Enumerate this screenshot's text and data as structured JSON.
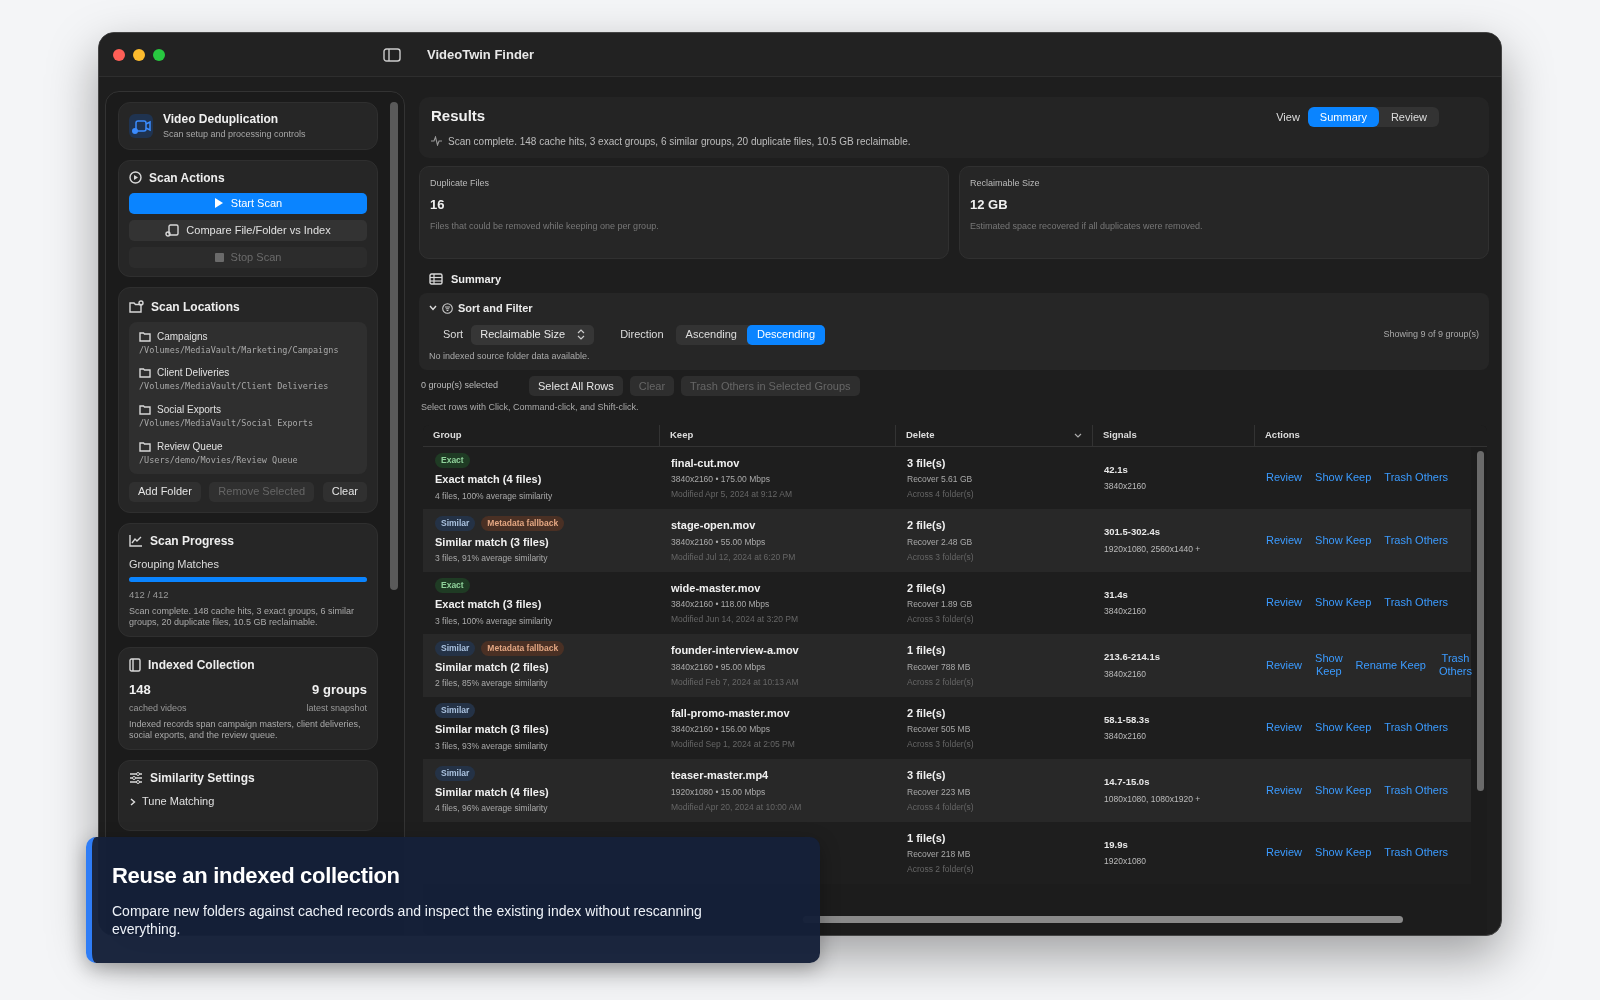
{
  "window": {
    "title": "VideoTwin Finder"
  },
  "sidebar": {
    "header": {
      "title": "Video Deduplication",
      "subtitle": "Scan setup and processing controls"
    },
    "scan_actions": {
      "title": "Scan Actions",
      "buttons": [
        {
          "label": "Start Scan",
          "kind": "primary"
        },
        {
          "label": "Compare File/Folder vs Index",
          "kind": "secondary"
        },
        {
          "label": "Stop Scan",
          "kind": "disabled"
        }
      ]
    },
    "scan_locations": {
      "title": "Scan Locations",
      "items": [
        {
          "name": "Campaigns",
          "path": "/Volumes/MediaVault/Marketing/Campaigns"
        },
        {
          "name": "Client Deliveries",
          "path": "/Volumes/MediaVault/Client Deliveries"
        },
        {
          "name": "Social Exports",
          "path": "/Volumes/MediaVault/Social Exports"
        },
        {
          "name": "Review Queue",
          "path": "/Users/demo/Movies/Review Queue"
        }
      ],
      "buttons": [
        {
          "label": "Add Folder",
          "disabled": false
        },
        {
          "label": "Remove Selected",
          "disabled": true
        },
        {
          "label": "Clear",
          "disabled": false
        }
      ]
    },
    "scan_progress": {
      "title": "Scan Progress",
      "stage": "Grouping Matches",
      "level": 1,
      "count": "412 / 412",
      "message": "Scan complete. 148 cache hits, 3 exact groups, 6 similar groups, 20 duplicate files, 10.5 GB reclaimable."
    },
    "indexed_collection": {
      "title": "Indexed Collection",
      "stats": [
        {
          "value": "148",
          "label": "cached videos"
        },
        {
          "value": "9 groups",
          "label": "latest snapshot"
        }
      ],
      "note": "Indexed records span campaign masters, client deliveries, social exports, and the review queue."
    },
    "similarity_settings": {
      "title": "Similarity Settings",
      "disclosure": {
        "label": "Tune Matching",
        "expanded": false
      }
    }
  },
  "results": {
    "title": "Results",
    "status": "Scan complete. 148 cache hits, 3 exact groups, 6 similar groups, 20 duplicate files, 10.5 GB reclaimable.",
    "view_label": "View",
    "view_tabs": [
      {
        "label": "Summary",
        "selected": true
      },
      {
        "label": "Review",
        "selected": false
      }
    ]
  },
  "stat_cards": [
    {
      "label": "Duplicate Files",
      "value": "16",
      "description": "Files that could be removed while keeping one per group."
    },
    {
      "label": "Reclaimable Size",
      "value": "12 GB",
      "description": "Estimated space recovered if all duplicates were removed."
    }
  ],
  "summary": {
    "title": "Summary",
    "sort_filter": {
      "title": "Sort and Filter",
      "expanded": true,
      "sort_label": "Sort",
      "sort_value": "Reclaimable Size",
      "direction_label": "Direction",
      "directions": [
        {
          "label": "Ascending",
          "selected": false
        },
        {
          "label": "Descending",
          "selected": true
        }
      ],
      "showing": "Showing 9 of 9 group(s)",
      "note": "No indexed source folder data available."
    },
    "selection": {
      "count": "0 group(s) selected",
      "buttons": [
        {
          "label": "Select All Rows",
          "disabled": false
        },
        {
          "label": "Clear",
          "disabled": true
        },
        {
          "label": "Trash Others in Selected Groups",
          "disabled": true
        }
      ],
      "hint": "Select rows with Click, Command-click, and Shift-click."
    }
  },
  "table": {
    "columns": [
      {
        "label": "Group",
        "sorted": false
      },
      {
        "label": "Keep",
        "sorted": false
      },
      {
        "label": "Delete",
        "sorted": true
      },
      {
        "label": "Signals",
        "sorted": false
      },
      {
        "label": "Actions",
        "sorted": false
      }
    ],
    "rows": [
      {
        "badges": [
          {
            "label": "Exact",
            "kind": "exact"
          }
        ],
        "group": "Exact match (4 files)",
        "group_detail": "4 files, 100% average similarity",
        "keep": "final-cut.mov",
        "keep_specs": "3840x2160 • 175.00 Mbps",
        "keep_modified": "Modified Apr 5, 2024 at 9:12 AM",
        "delete": "3 file(s)",
        "recover": "Recover 5.61 GB",
        "across": "Across 4 folder(s)",
        "duration": "42.1s",
        "resolution": "3840x2160",
        "actions": [
          "Review",
          "Show Keep",
          "Trash Others"
        ]
      },
      {
        "badges": [
          {
            "label": "Similar",
            "kind": "similar"
          },
          {
            "label": "Metadata fallback",
            "kind": "fallback"
          }
        ],
        "group": "Similar match (3 files)",
        "group_detail": "3 files, 91% average similarity",
        "keep": "stage-open.mov",
        "keep_specs": "3840x2160 • 55.00 Mbps",
        "keep_modified": "Modified Jul 12, 2024 at 6:20 PM",
        "delete": "2 file(s)",
        "recover": "Recover 2.48 GB",
        "across": "Across 3 folder(s)",
        "duration": "301.5-302.4s",
        "resolution": "1920x1080, 2560x1440 +",
        "actions": [
          "Review",
          "Show Keep",
          "Trash Others"
        ]
      },
      {
        "badges": [
          {
            "label": "Exact",
            "kind": "exact"
          }
        ],
        "group": "Exact match (3 files)",
        "group_detail": "3 files, 100% average similarity",
        "keep": "wide-master.mov",
        "keep_specs": "3840x2160 • 118.00 Mbps",
        "keep_modified": "Modified Jun 14, 2024 at 3:20 PM",
        "delete": "2 file(s)",
        "recover": "Recover 1.89 GB",
        "across": "Across 3 folder(s)",
        "duration": "31.4s",
        "resolution": "3840x2160",
        "actions": [
          "Review",
          "Show Keep",
          "Trash Others"
        ]
      },
      {
        "badges": [
          {
            "label": "Similar",
            "kind": "similar"
          },
          {
            "label": "Metadata fallback",
            "kind": "fallback"
          }
        ],
        "group": "Similar match (2 files)",
        "group_detail": "2 files, 85% average similarity",
        "keep": "founder-interview-a.mov",
        "keep_specs": "3840x2160 • 95.00 Mbps",
        "keep_modified": "Modified Feb 7, 2024 at 10:13 AM",
        "delete": "1 file(s)",
        "recover": "Recover 788 MB",
        "across": "Across 2 folder(s)",
        "duration": "213.6-214.1s",
        "resolution": "3840x2160",
        "actions": [
          "Review",
          "Show Keep",
          "Rename Keep",
          "Trash Others"
        ]
      },
      {
        "badges": [
          {
            "label": "Similar",
            "kind": "similar"
          }
        ],
        "group": "Similar match (3 files)",
        "group_detail": "3 files, 93% average similarity",
        "keep": "fall-promo-master.mov",
        "keep_specs": "3840x2160 • 156.00 Mbps",
        "keep_modified": "Modified Sep 1, 2024 at 2:05 PM",
        "delete": "2 file(s)",
        "recover": "Recover 505 MB",
        "across": "Across 3 folder(s)",
        "duration": "58.1-58.3s",
        "resolution": "3840x2160",
        "actions": [
          "Review",
          "Show Keep",
          "Trash Others"
        ]
      },
      {
        "badges": [
          {
            "label": "Similar",
            "kind": "similar"
          }
        ],
        "group": "Similar match (4 files)",
        "group_detail": "4 files, 96% average similarity",
        "keep": "teaser-master.mp4",
        "keep_specs": "1920x1080 • 15.00 Mbps",
        "keep_modified": "Modified Apr 20, 2024 at 10:00 AM",
        "delete": "3 file(s)",
        "recover": "Recover 223 MB",
        "across": "Across 4 folder(s)",
        "duration": "14.7-15.0s",
        "resolution": "1080x1080, 1080x1920 +",
        "actions": [
          "Review",
          "Show Keep",
          "Trash Others"
        ]
      },
      {
        "badges": [],
        "delete": "1 file(s)",
        "recover": "Recover 218 MB",
        "across": "Across 2 folder(s)",
        "duration": "19.9s",
        "resolution": "1920x1080",
        "actions": [
          "Review",
          "Show Keep",
          "Trash Others"
        ]
      }
    ]
  },
  "callout": {
    "title": "Reuse an indexed collection",
    "body": "Compare new folders against cached records and inspect the existing index without rescanning everything."
  }
}
